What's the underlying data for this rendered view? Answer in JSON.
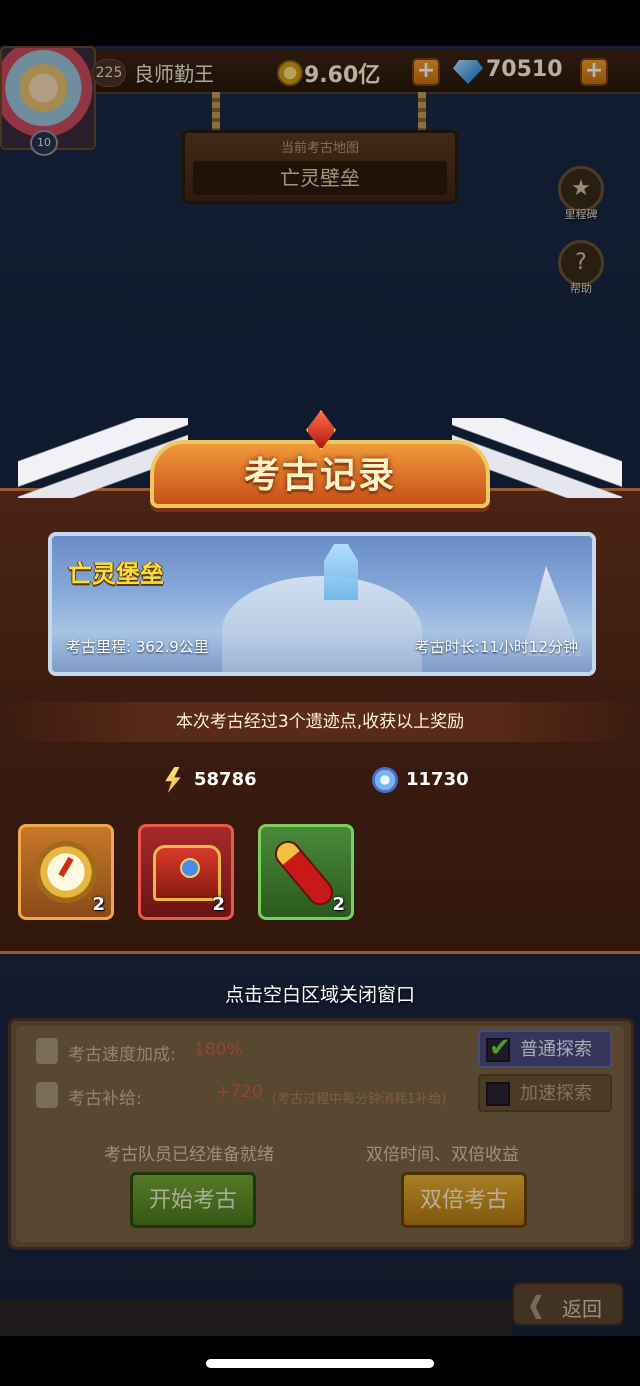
{
  "topbar": {
    "avatar_level": "10",
    "player_level": "225",
    "player_name": "良师勤王",
    "gold": "9.60亿",
    "gems": "70510",
    "plus_icon": "plus-icon"
  },
  "map_sign": {
    "label": "当前考古地图",
    "name": "亡灵壁垒"
  },
  "side_buttons": {
    "milestone_label": "里程碑",
    "help_label": "帮助"
  },
  "modal": {
    "title": "考古记录",
    "map_name": "亡灵堡垒",
    "distance_text": "考古里程: 362.9公里",
    "duration_text": "考古时长:11小时12分钟",
    "summary": "本次考古经过3个遗迹点,收获以上奖励",
    "resources": [
      {
        "icon": "lightning-icon",
        "value": "58786"
      },
      {
        "icon": "crystal-icon",
        "value": "11730"
      }
    ],
    "items": [
      {
        "icon": "stopwatch-icon",
        "count": "2",
        "rarity_color": "#f0a848"
      },
      {
        "icon": "treasure-chest-icon",
        "count": "2",
        "rarity_color": "#e85a4a"
      },
      {
        "icon": "potion-icon",
        "count": "2",
        "rarity_color": "#7ad05a"
      }
    ],
    "close_hint": "点击空白区域关闭窗口"
  },
  "panel": {
    "speed_label": "考古速度加成:",
    "speed_value": "180%",
    "supply_label": "考古补给:",
    "supply_value": "+720",
    "supply_note": "(考古过程中每分钟消耗1补给)",
    "mode_normal": "普通探索",
    "mode_fast": "加速探索",
    "ready_caption": "考古队员已经准备就绪",
    "double_caption": "双倍时间、双倍收益",
    "start_button": "开始考古",
    "double_button": "双倍考古"
  },
  "back_button": "返回"
}
